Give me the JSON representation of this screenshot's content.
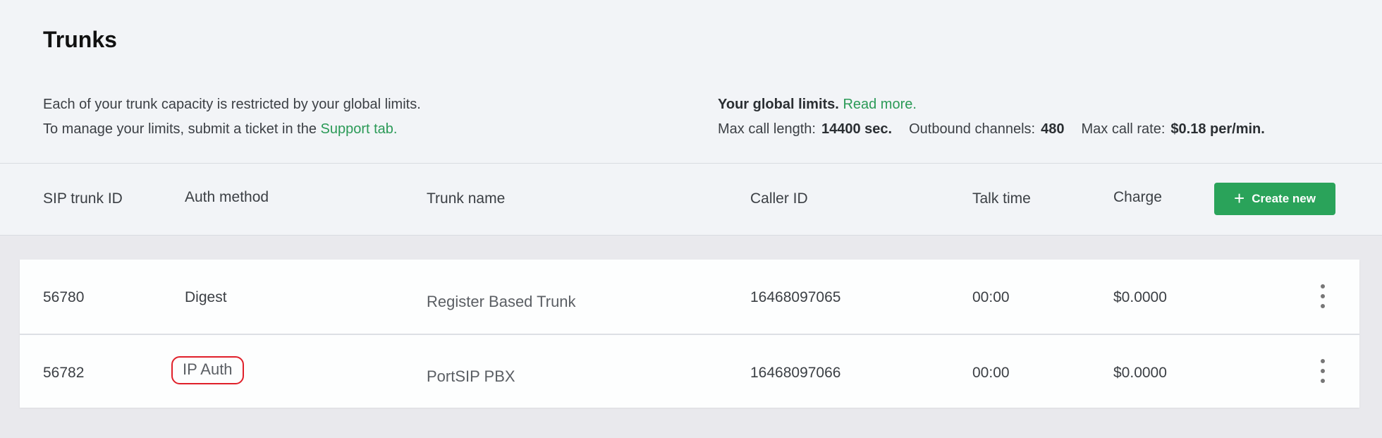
{
  "page": {
    "title": "Trunks"
  },
  "info": {
    "line1": "Each of your trunk capacity is restricted by your global limits.",
    "line2_prefix": "To manage your limits, submit a ticket in the",
    "line2_link": "Support tab."
  },
  "limits": {
    "title": "Your global limits.",
    "read_more": "Read more.",
    "max_call_length_label": "Max call length:",
    "max_call_length_value": "14400 sec.",
    "outbound_channels_label": "Outbound channels:",
    "outbound_channels_value": "480",
    "max_call_rate_label": "Max call rate:",
    "max_call_rate_value": "$0.18 per/min."
  },
  "table": {
    "columns": [
      "SIP trunk ID",
      "Auth method",
      "Trunk name",
      "Caller ID",
      "Talk time",
      "Charge"
    ],
    "create_button": "Create new",
    "rows": [
      {
        "id": "56780",
        "auth": "Digest",
        "name": "Register Based Trunk",
        "caller_id": "16468097065",
        "talk_time": "00:00",
        "charge": "$0.0000"
      },
      {
        "id": "56782",
        "auth": "IP Auth",
        "name": "PortSIP PBX",
        "caller_id": "16468097066",
        "talk_time": "00:00",
        "charge": "$0.0000"
      }
    ]
  },
  "colors": {
    "accent": "#2aa35a",
    "link": "#2b9a57",
    "highlight": "#e0202a"
  }
}
